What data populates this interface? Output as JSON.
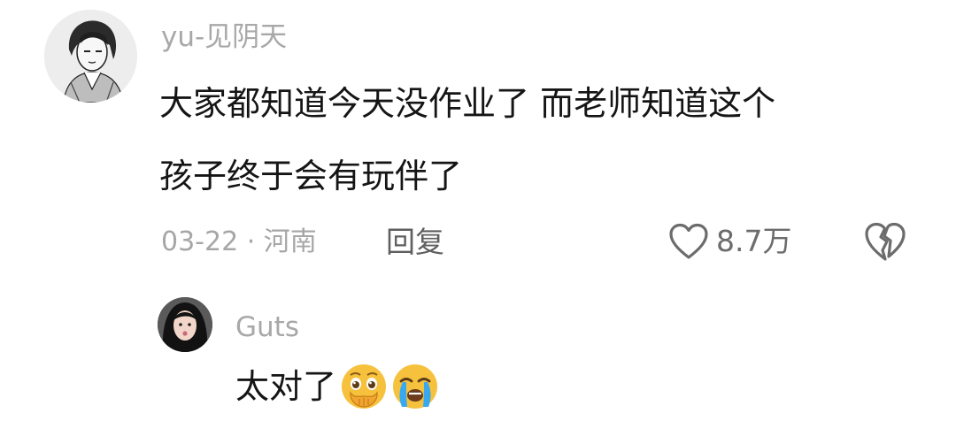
{
  "comment": {
    "username": "yu-见阴天",
    "content_lines": [
      "大家都知道今天没作业了 而老师知道这个",
      "孩子终于会有玩伴了"
    ],
    "meta": "03-22 · 河南",
    "reply_label": "回复",
    "like_count": "8.7万"
  },
  "reply": {
    "username": "Guts",
    "content": "太对了",
    "emojis": [
      "pleading-face-hands-emoji",
      "crying-face-emoji"
    ]
  },
  "colors": {
    "username": "#a8a8a8",
    "content": "#151515",
    "meta": "#a6a6a6",
    "reply_button": "#5f5f5f",
    "icon": "#6c6c6c",
    "emoji_yellow": "#f6c23e",
    "emoji_blue": "#38a8ef"
  }
}
